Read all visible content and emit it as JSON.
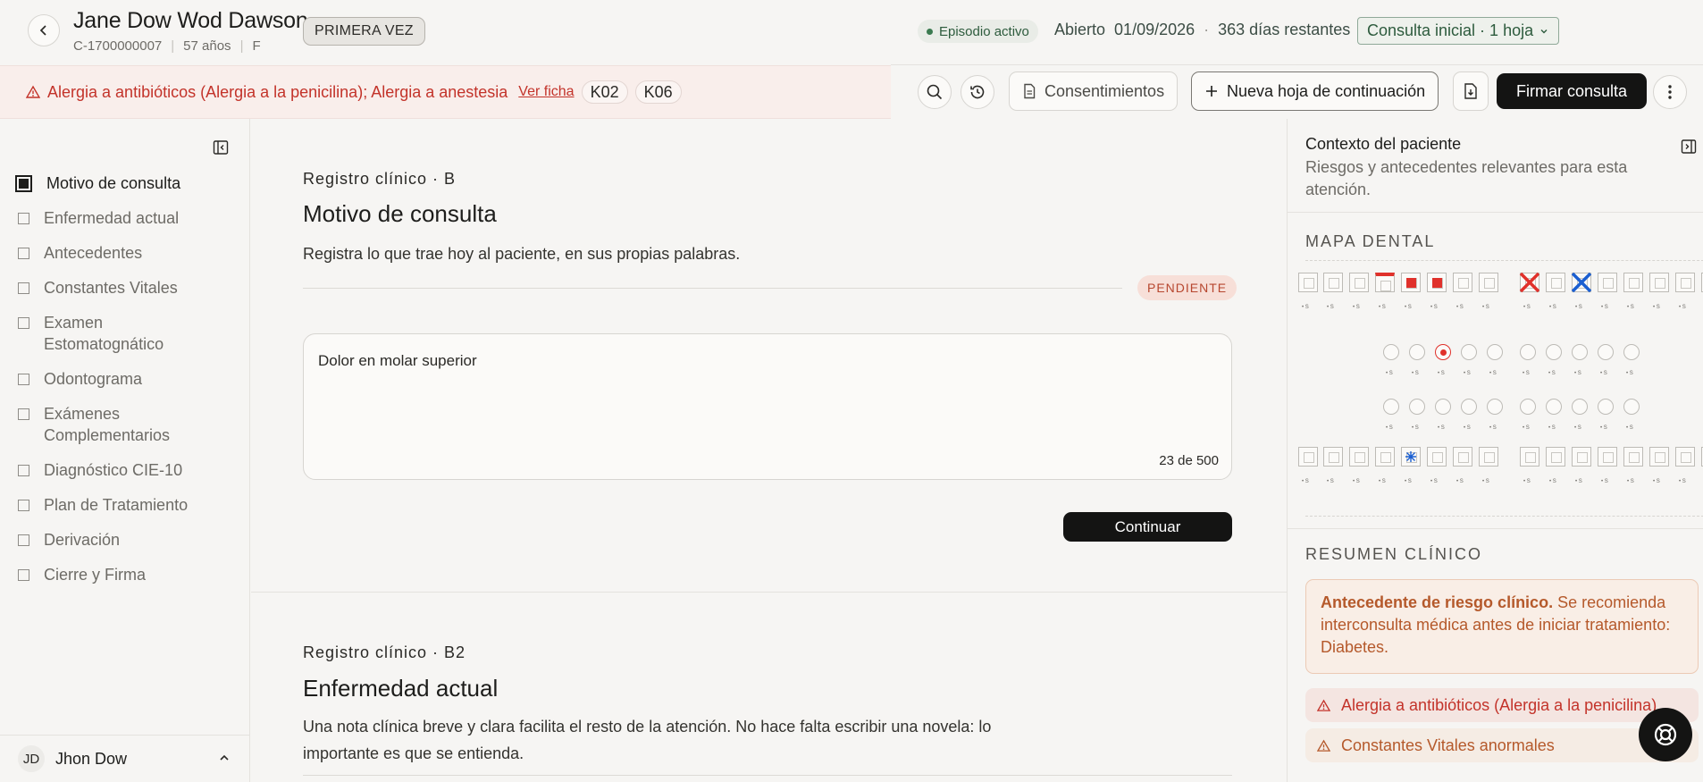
{
  "patient": {
    "name": "Jane Dow Wod Dawson",
    "id": "C-1700000007",
    "age": "57 años",
    "sex": "F",
    "visit_badge": "PRIMERA VEZ"
  },
  "episode": {
    "status": "Episodio activo",
    "opened_label": "Abierto",
    "opened_date": "01/09/2026",
    "separator": "·",
    "remaining": "363 días restantes",
    "consulta_select": "Consulta inicial · 1 hoja"
  },
  "allergy_bar": {
    "text": "Alergia a antibióticos (Alergia a la penicilina); Alergia a anestesia",
    "link": "Ver ficha",
    "codes": [
      "K02",
      "K06"
    ]
  },
  "toolbar": {
    "consent_label": "Consentimientos",
    "new_sheet_label": "Nueva hoja de continuación",
    "sign_label": "Firmar consulta"
  },
  "sidebar": {
    "items": [
      {
        "label": "Motivo de consulta",
        "active": true
      },
      {
        "label": "Enfermedad actual",
        "active": false
      },
      {
        "label": "Antecedentes",
        "active": false
      },
      {
        "label": "Constantes Vitales",
        "active": false
      },
      {
        "label": "Examen Estomatognático",
        "active": false
      },
      {
        "label": "Odontograma",
        "active": false
      },
      {
        "label": "Exámenes Complementarios",
        "active": false
      },
      {
        "label": "Diagnóstico CIE-10",
        "active": false
      },
      {
        "label": "Plan de Tratamiento",
        "active": false
      },
      {
        "label": "Derivación",
        "active": false
      },
      {
        "label": "Cierre y Firma",
        "active": false
      }
    ],
    "user": {
      "initials": "JD",
      "name": "Jhon Dow"
    }
  },
  "main": {
    "section1": {
      "kicker": "Registro clínico · B",
      "title": "Motivo de consulta",
      "description": "Registra lo que trae hoy al paciente, en sus propias palabras.",
      "status": "PENDIENTE",
      "value": "Dolor en molar superior",
      "counter": "23 de 500",
      "continue_label": "Continuar"
    },
    "section2": {
      "kicker": "Registro clínico · B2",
      "title": "Enfermedad actual",
      "description": "Una nota clínica breve y clara facilita el resto de la atención. No hace falta escribir una novela: lo importante es que se entienda."
    }
  },
  "panel": {
    "title": "Contexto del paciente",
    "subtitle": "Riesgos y antecedentes relevantes para esta atención.",
    "dental_map_label": "MAPA DENTAL",
    "summary_label": "RESUMEN CLÍNICO",
    "risk_card": {
      "bold": "Antecedente de riesgo clínico.",
      "text": "Se recomienda interconsulta médica antes de iniciar tratamiento: Diabetes."
    },
    "alerts": [
      {
        "text": "Alergia a antibióticos (Alergia a la penicilina)",
        "tone": "red"
      },
      {
        "text": "Constantes Vitales anormales",
        "tone": "orange"
      }
    ]
  },
  "colors": {
    "accent": "#141413",
    "danger": "#c3332a",
    "warning": "#b5592b",
    "episode_green": "#2d5b3d",
    "tooth_red": "#e0312b",
    "tooth_blue": "#1b5fd1"
  }
}
